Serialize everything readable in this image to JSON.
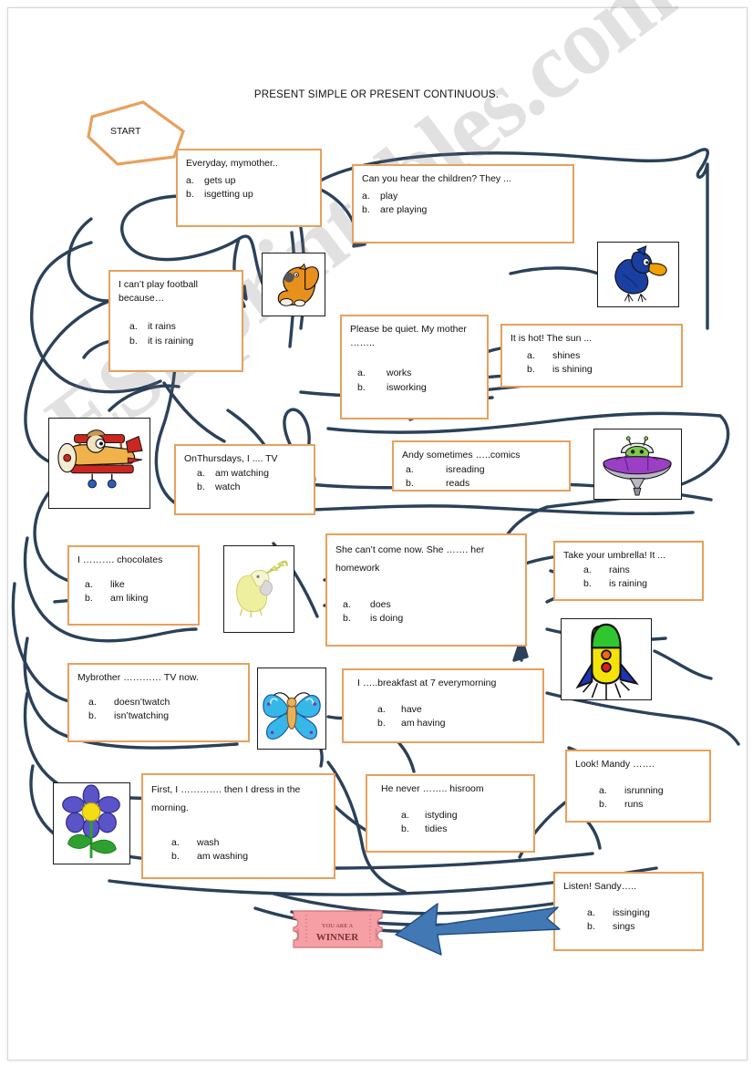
{
  "page": {
    "title": "PRESENT SIMPLE OR PRESENT CONTINUOUS.",
    "start_label": "START",
    "watermark": "ESLprintables.com",
    "ticket_small": "YOU ARE A",
    "ticket_big": "WINNER"
  },
  "colors": {
    "box_border": "#E8A05C",
    "maze_line": "#2B4159",
    "arrow": "#3E6FA8",
    "ticket": "#F6A0A6",
    "text": "#111111"
  },
  "questions": [
    {
      "id": "q1-everyday-mother",
      "stem": "Everyday, mymother..",
      "options": [
        {
          "letter": "a.",
          "text": "gets up"
        },
        {
          "letter": "b.",
          "text": "isgetting up"
        }
      ]
    },
    {
      "id": "q2-hear-children",
      "stem": "Can you hear the children?  They ...",
      "options": [
        {
          "letter": "a.",
          "text": "play"
        },
        {
          "letter": "b.",
          "text": "are playing"
        }
      ]
    },
    {
      "id": "q3-play-football",
      "stem": "I can’t play football because…",
      "options": [
        {
          "letter": "a.",
          "text": "it rains"
        },
        {
          "letter": "b.",
          "text": "it is raining"
        }
      ]
    },
    {
      "id": "q4-be-quiet",
      "stem": "Please be quiet.  My mother ……..",
      "options": [
        {
          "letter": "a.",
          "text": "works"
        },
        {
          "letter": "b.",
          "text": "isworking"
        }
      ]
    },
    {
      "id": "q5-sun-hot",
      "stem": "It is hot!  The sun ...",
      "options": [
        {
          "letter": "a.",
          "text": "shines"
        },
        {
          "letter": "b.",
          "text": "is shining"
        }
      ]
    },
    {
      "id": "q6-thursdays-tv",
      "stem": "OnThursdays,  I .... TV",
      "options": [
        {
          "letter": "a.",
          "text": "am watching"
        },
        {
          "letter": "b.",
          "text": "watch"
        }
      ]
    },
    {
      "id": "q7-andy-comics",
      "stem": "Andy sometimes …..comics",
      "options": [
        {
          "letter": "a.",
          "text": "isreading"
        },
        {
          "letter": "b.",
          "text": "reads"
        }
      ]
    },
    {
      "id": "q8-chocolates",
      "stem": "I ………. chocolates",
      "options": [
        {
          "letter": "a.",
          "text": "like"
        },
        {
          "letter": "b.",
          "text": "am liking"
        }
      ]
    },
    {
      "id": "q9-homework",
      "stem": "She can’t come now.  She ……. her homework",
      "options": [
        {
          "letter": "a.",
          "text": "does"
        },
        {
          "letter": "b.",
          "text": "is doing"
        }
      ]
    },
    {
      "id": "q10-umbrella",
      "stem": "Take your umbrella! It ...",
      "options": [
        {
          "letter": "a.",
          "text": "rains"
        },
        {
          "letter": "b.",
          "text": "is raining"
        }
      ]
    },
    {
      "id": "q11-brother-tv",
      "stem": "Mybrother ………… TV now.",
      "options": [
        {
          "letter": "a.",
          "text": "doesn’twatch"
        },
        {
          "letter": "b.",
          "text": "isn’twatching"
        }
      ]
    },
    {
      "id": "q12-breakfast",
      "stem": "I …..breakfast at  7 everymorning",
      "options": [
        {
          "letter": "a.",
          "text": "have"
        },
        {
          "letter": "b.",
          "text": "am having"
        }
      ]
    },
    {
      "id": "q13-mandy",
      "stem": "Look!  Mandy …….",
      "options": [
        {
          "letter": "a.",
          "text": "isrunning"
        },
        {
          "letter": "b.",
          "text": "runs"
        }
      ]
    },
    {
      "id": "q14-first-wash",
      "stem": "First, I …………. then I dress in the morning.",
      "options": [
        {
          "letter": "a.",
          "text": "wash"
        },
        {
          "letter": "b.",
          "text": "am washing"
        }
      ]
    },
    {
      "id": "q15-his-room",
      "stem": "He never …….. hisroom",
      "options": [
        {
          "letter": "a.",
          "text": "istyding"
        },
        {
          "letter": "b.",
          "text": "tidies"
        }
      ]
    },
    {
      "id": "q16-sandy-sings",
      "stem": "Listen! Sandy…..",
      "options": [
        {
          "letter": "a.",
          "text": "issinging"
        },
        {
          "letter": "b.",
          "text": "sings"
        }
      ]
    }
  ],
  "pictures": [
    {
      "id": "squirrel",
      "name": "squirrel-picture"
    },
    {
      "id": "bird",
      "name": "blue-bird-picture"
    },
    {
      "id": "airplane",
      "name": "biplane-picture"
    },
    {
      "id": "ufo",
      "name": "ufo-picture"
    },
    {
      "id": "duck",
      "name": "yellow-duck-picture"
    },
    {
      "id": "rocket",
      "name": "rocket-picture"
    },
    {
      "id": "butterfly",
      "name": "butterfly-picture"
    },
    {
      "id": "flower",
      "name": "flower-picture"
    }
  ]
}
